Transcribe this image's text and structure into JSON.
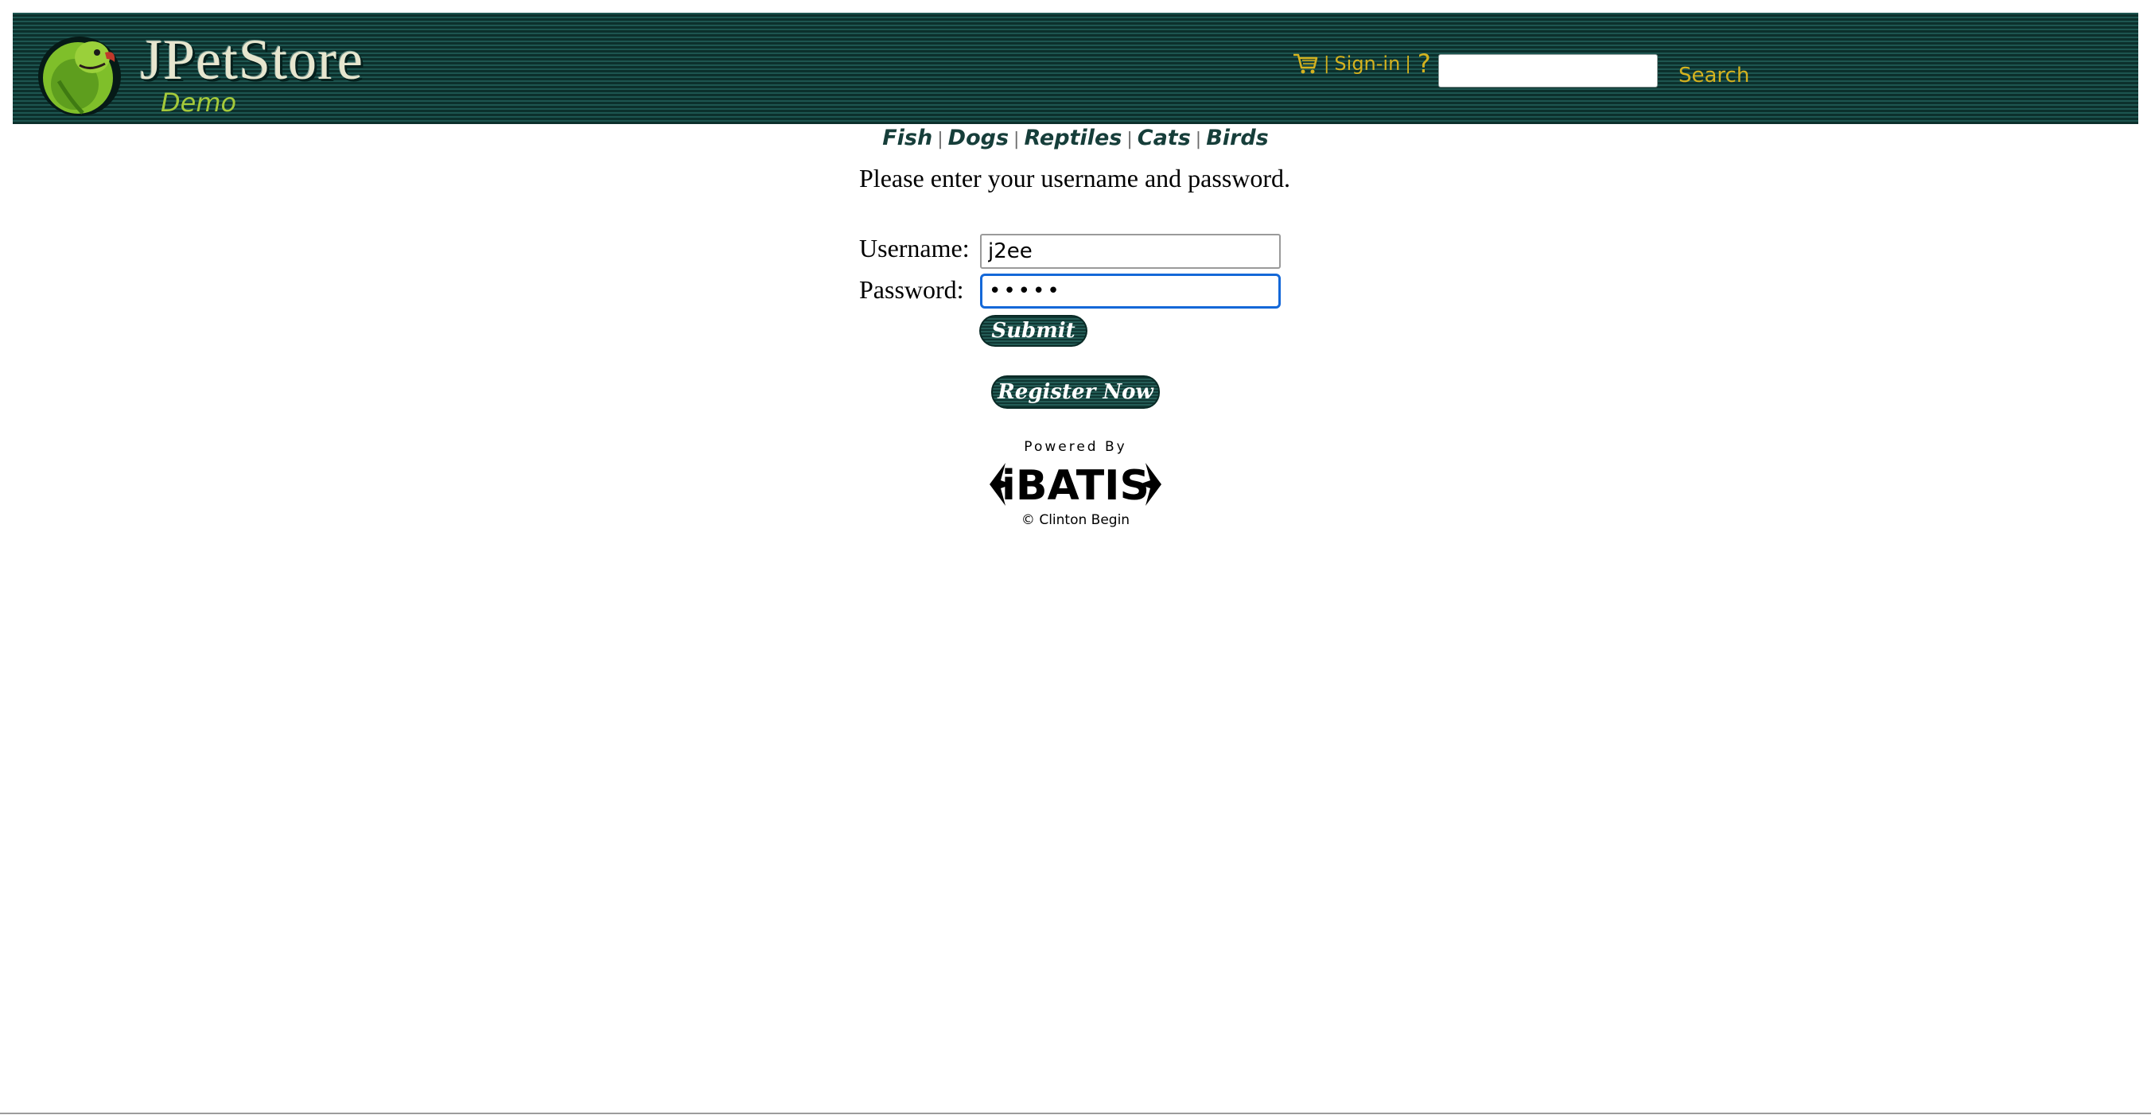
{
  "header": {
    "brand_name": "JPetStore",
    "brand_sub": "Demo",
    "cart_icon": "shopping-cart-icon",
    "separator": "|",
    "signin_label": "Sign-in",
    "help_label": "?",
    "search_value": "",
    "search_label": "Search"
  },
  "categories": {
    "fish": "Fish",
    "dogs": "Dogs",
    "reptiles": "Reptiles",
    "cats": "Cats",
    "birds": "Birds",
    "separator": "|"
  },
  "login": {
    "prompt": "Please enter your username and password.",
    "username_label": "Username:",
    "username_value": "j2ee",
    "password_label": "Password:",
    "password_value": "•••••",
    "submit_label": "Submit",
    "register_label": "Register Now"
  },
  "footer": {
    "powered_by": "Powered By",
    "logo_text": "iBATIS",
    "copyright": "© Clinton Begin"
  },
  "colors": {
    "header_bg": "#14423d",
    "header_link": "#d4b21f",
    "brand_sub": "#a4c93a",
    "nav_text": "#163e3a",
    "focus_ring": "#1468d8"
  }
}
